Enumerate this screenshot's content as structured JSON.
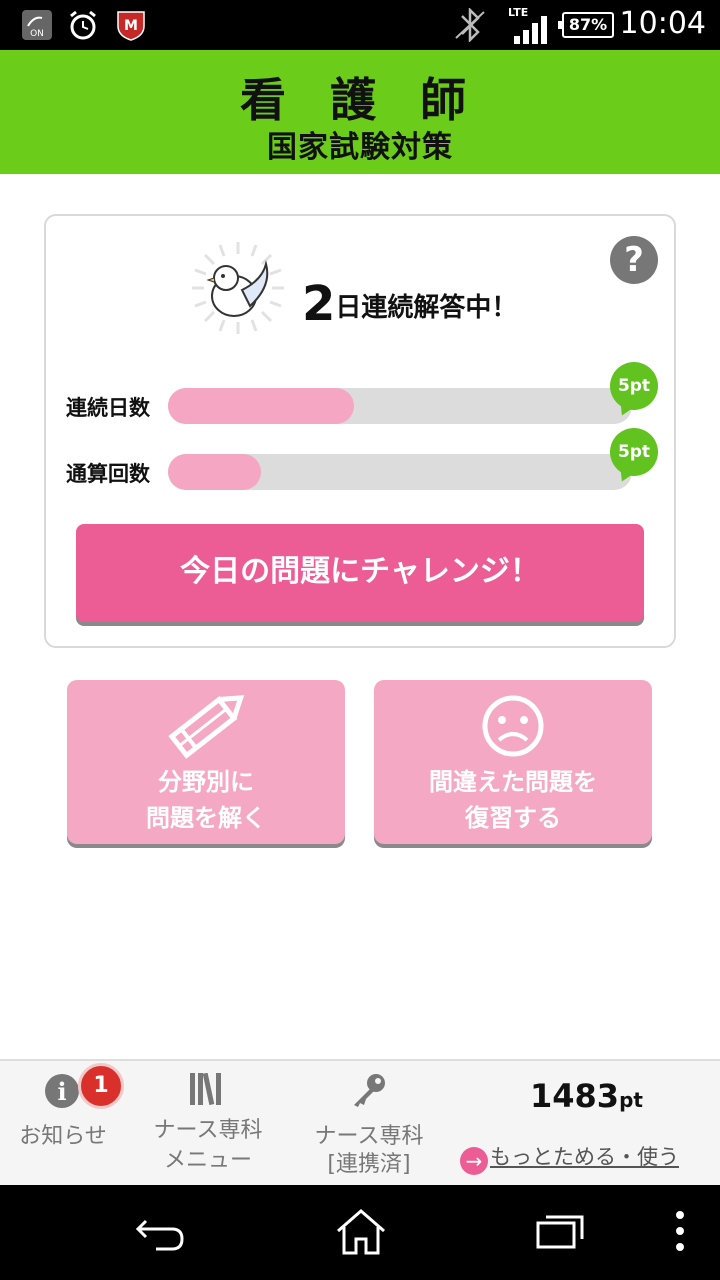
{
  "status_bar": {
    "battery": "87%",
    "network": "LTE",
    "time": "10:04",
    "icons": [
      "nfc-on-icon",
      "alarm-icon",
      "mcafee-icon",
      "bluetooth-icon",
      "signal-icon",
      "battery-icon"
    ]
  },
  "header": {
    "title": "看 護 師",
    "subtitle": "国家試験対策"
  },
  "card": {
    "streak_number": "2",
    "streak_text": "日連続解答中！",
    "rows": [
      {
        "label": "連続日数",
        "progress": 0.4,
        "badge": "5pt"
      },
      {
        "label": "通算回数",
        "progress": 0.2,
        "badge": "5pt"
      }
    ],
    "challenge_label": "今日の問題にチャレンジ！"
  },
  "tiles": [
    {
      "line1": "分野別に",
      "line2": "問題を解く",
      "icon": "pencil-icon"
    },
    {
      "line1": "間違えた問題を",
      "line2": "復習する",
      "icon": "sad-face-icon"
    }
  ],
  "bottom_bar": {
    "notice_label": "お知らせ",
    "notice_count": "1",
    "menu_line1": "ナース専科",
    "menu_line2": "メニュー",
    "linked_line1": "ナース専科",
    "linked_line2": "[連携済]",
    "points_value": "1483",
    "points_unit": "pt",
    "more_link": "もっとためる・使う"
  },
  "colors": {
    "header_green": "#6ccc1a",
    "accent_pink": "#ec5d96",
    "tile_pink": "#f4a8c4",
    "badge_green": "#62c320"
  }
}
